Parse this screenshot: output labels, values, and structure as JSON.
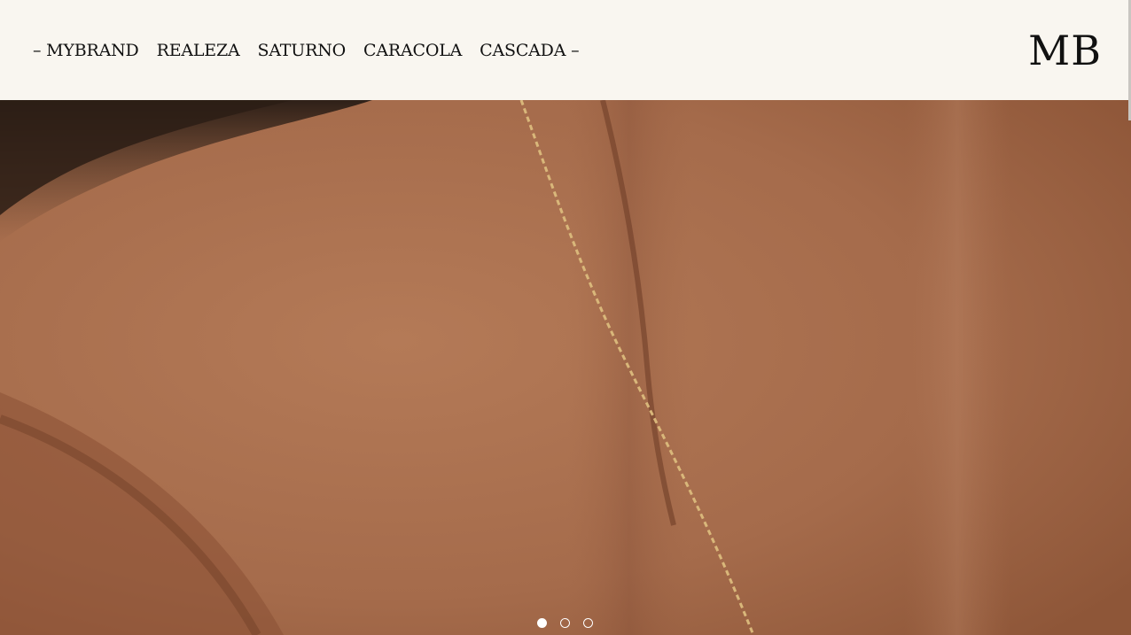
{
  "header": {
    "nav": [
      {
        "label": "– MYBRAND"
      },
      {
        "label": "REALEZA"
      },
      {
        "label": "SATURNO"
      },
      {
        "label": "CARACOLA"
      },
      {
        "label": "CASCADA –"
      }
    ],
    "logo": "MB"
  },
  "hero": {
    "image_subject": "close-up of neck and shoulder with gold chain necklace",
    "colors": {
      "skin": "#a36a4a",
      "hair": "#3a2a20",
      "chain": "#d9b77a"
    }
  },
  "carousel": {
    "slide_count": 3,
    "active_index": 0
  }
}
